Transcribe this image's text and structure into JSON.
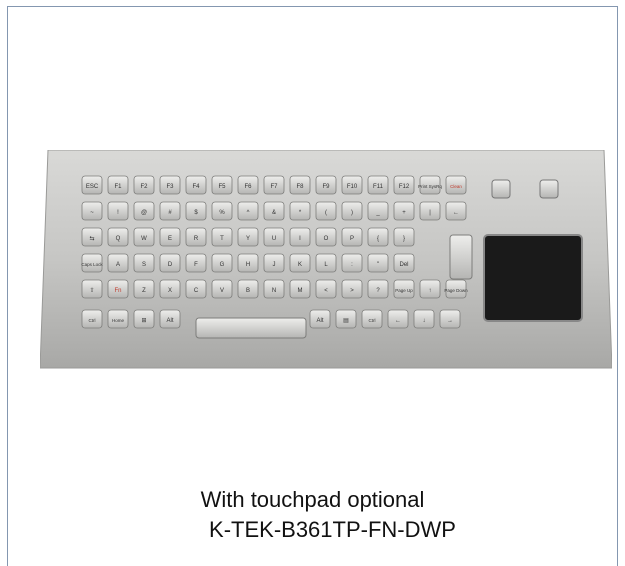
{
  "caption": {
    "line1": "With touchpad optional",
    "line2": "K-TEK-B361TP-FN-DWP"
  },
  "keyboard": {
    "row1": [
      "ESC",
      "F1",
      "F2",
      "F3",
      "F4",
      "F5",
      "F6",
      "F7",
      "F8",
      "F9",
      "F10",
      "F11",
      "F12",
      "Print SysRq",
      "Clean"
    ],
    "row2": [
      "~",
      "!",
      "@",
      "#",
      "$",
      "%",
      "^",
      "&",
      "*",
      "(",
      ")",
      "_",
      "+",
      "|",
      "←"
    ],
    "row3": [
      "⇆",
      "Q",
      "W",
      "E",
      "R",
      "T",
      "Y",
      "U",
      "I",
      "O",
      "P",
      "{",
      "}"
    ],
    "row4": [
      "Caps Lock",
      "A",
      "S",
      "D",
      "F",
      "G",
      "H",
      "J",
      "K",
      "L",
      ":",
      "\"",
      "Del"
    ],
    "row5": [
      "⇧",
      "Fn",
      "Z",
      "X",
      "C",
      "V",
      "B",
      "N",
      "M",
      "<",
      ">",
      "?",
      "Page Up",
      "↑",
      "Page Down"
    ],
    "row6": [
      "Ctrl",
      "Home",
      "⊞",
      "Alt",
      "",
      "Alt",
      "▤",
      "Ctrl",
      "←",
      "↓",
      "→"
    ]
  }
}
